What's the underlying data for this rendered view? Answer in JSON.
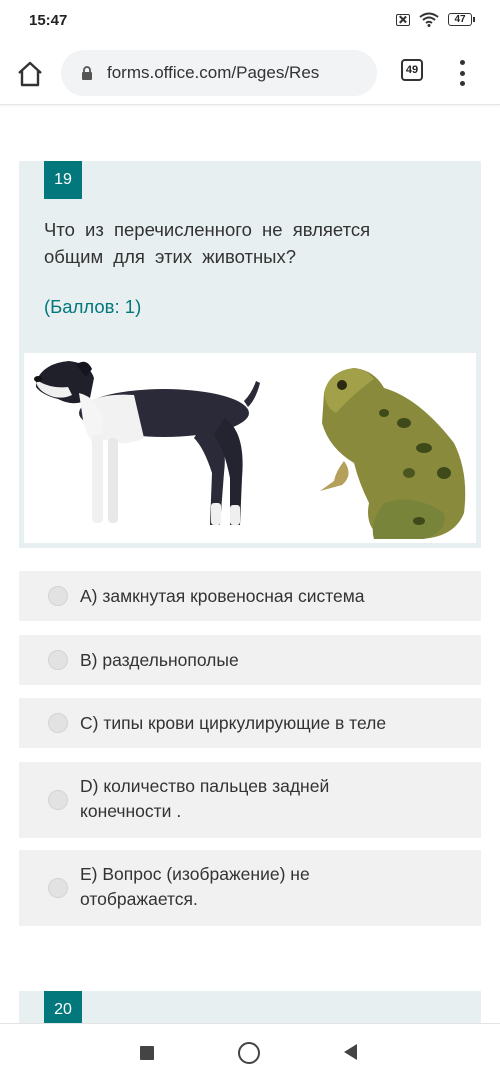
{
  "status_bar": {
    "time": "15:47",
    "battery": "47"
  },
  "browser": {
    "url": "forms.office.com/Pages/Res",
    "tab_count": "49"
  },
  "question": {
    "number": "19",
    "text": "Что из перечисленного не является общим для этих животных?",
    "points": "(Баллов: 1)"
  },
  "options": [
    {
      "label": "A) замкнутая кровеносная система"
    },
    {
      "label": "B) раздельнополые"
    },
    {
      "label": "C) типы крови циркулирующие в теле"
    },
    {
      "label": "D) количество пальцев задней конечности ."
    },
    {
      "label": "E) Вопрос (изображение) не отображается."
    }
  ],
  "next_question": {
    "number": "20"
  },
  "colors": {
    "accent": "#03787c",
    "card_bg": "#e8eff0",
    "option_bg": "#f1f1f1"
  }
}
